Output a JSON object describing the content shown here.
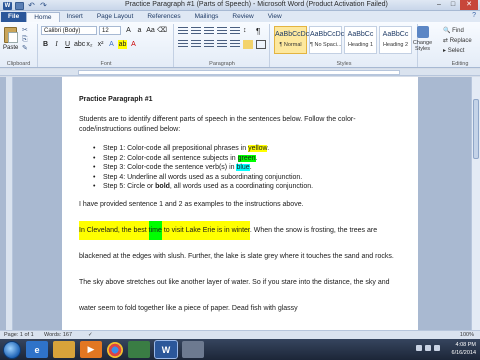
{
  "window": {
    "title": "Practice Paragraph #1 (Parts of Speech) - Microsoft Word (Product Activation Failed)"
  },
  "tabs": [
    "File",
    "Home",
    "Insert",
    "Page Layout",
    "References",
    "Mailings",
    "Review",
    "View"
  ],
  "ribbon": {
    "clipboard": {
      "paste_label": "Paste",
      "group_label": "Clipboard"
    },
    "font": {
      "name": "Calibri (Body)",
      "size": "12",
      "group_label": "Font"
    },
    "paragraph": {
      "group_label": "Paragraph"
    },
    "styles": {
      "group_label": "Styles",
      "items": [
        {
          "sample": "AaBbCcDc",
          "name": "¶ Normal"
        },
        {
          "sample": "AaBbCcDc",
          "name": "¶ No Spaci..."
        },
        {
          "sample": "AaBbCc",
          "name": "Heading 1"
        },
        {
          "sample": "AaBbCc",
          "name": "Heading 2"
        }
      ],
      "change_styles": "Change Styles"
    },
    "editing": {
      "find": "Find",
      "replace": "Replace",
      "select": "Select",
      "group_label": "Editing"
    }
  },
  "document": {
    "title": "Practice Paragraph #1",
    "intro": "Students are to identify different parts of speech in the sentences below. Follow the color-code/instructions outlined below:",
    "steps": [
      {
        "before": "Step 1: Color-code all prepositional phrases in ",
        "highlight": "yellow",
        "color": "yellow",
        "after": "."
      },
      {
        "before": "Step 2: Color-code all sentence subjects in ",
        "highlight": "green",
        "color": "green",
        "after": "."
      },
      {
        "before": "Step 3: Color-code the sentence verb(s) in ",
        "highlight": "blue",
        "color": "cyan",
        "after": "."
      },
      {
        "before": "Step 4: Underline all words used as a subordinating conjunction.",
        "highlight": "",
        "color": "",
        "after": ""
      },
      {
        "before": "Step 5: Circle or ",
        "highlight": "bold",
        "color": "bold",
        "after": ", all words used as a coordinating conjunction."
      }
    ],
    "example_sentence": "I have provided sentence 1 and 2 as examples to the instructions above.",
    "paragraph": {
      "seg1": "In Cleveland",
      "seg2": ", the best ",
      "seg3": "time",
      "seg4": " to visit Lake Erie",
      "seg5": " is ",
      "seg6": "in winter",
      "seg7": ". When the snow is frosting, the trees are blackened at the edges with slush. Further, the lake is slate grey where it touches the sand and rocks. The sky above stretches out like another layer of water. So if you stare into the distance, the sky and water seem to fold together like a piece of paper. Dead fish with glassy"
    }
  },
  "status": {
    "page": "Page: 1 of 1",
    "words": "Words: 167",
    "zoom": "100%"
  },
  "tray": {
    "time": "4:08 PM",
    "date": "6/16/2014"
  },
  "colors": {
    "accent": "#2b579a",
    "highlight_yellow": "#ffff00",
    "highlight_green": "#00ff00",
    "highlight_blue": "#00ffff"
  }
}
